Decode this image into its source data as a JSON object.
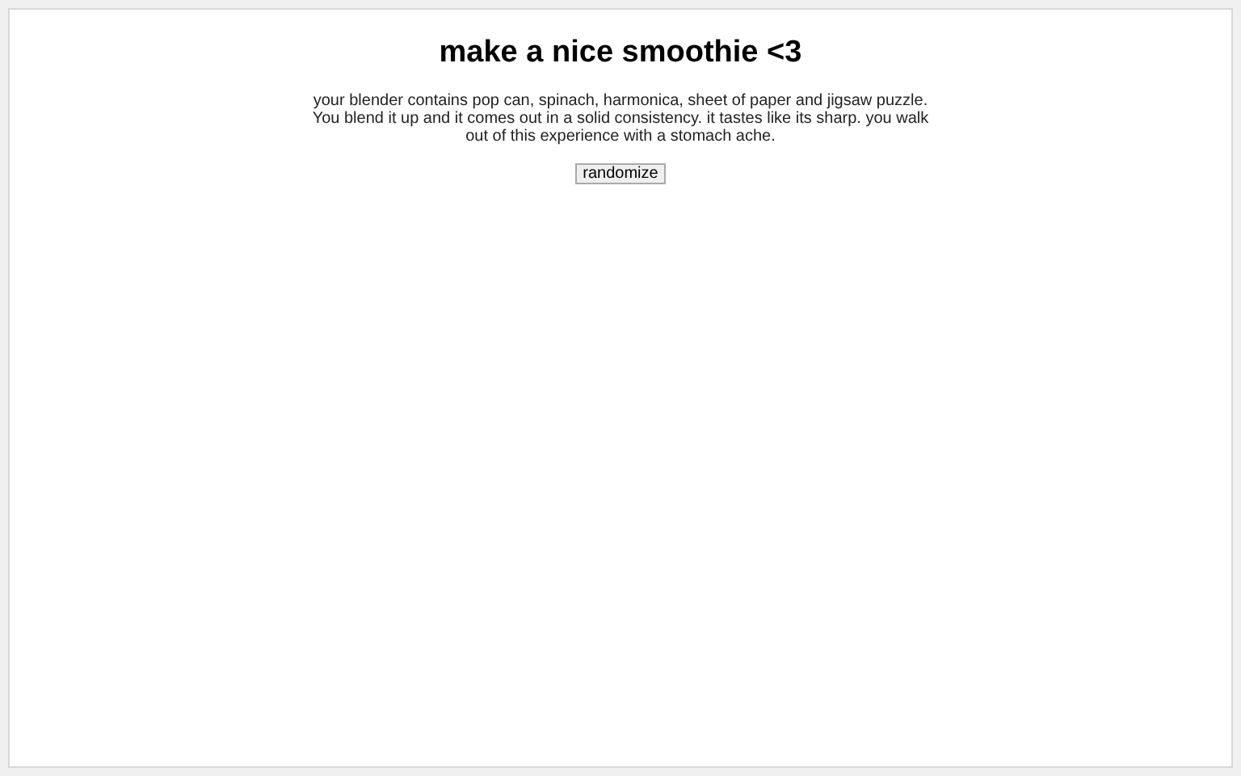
{
  "title": "make a nice smoothie <3",
  "description": "your blender contains pop can, spinach, harmonica, sheet of paper and jigsaw puzzle. You blend it up and it comes out in a solid consistency. it tastes like its sharp. you walk out of this experience with a stomach ache.",
  "button": "randomize"
}
